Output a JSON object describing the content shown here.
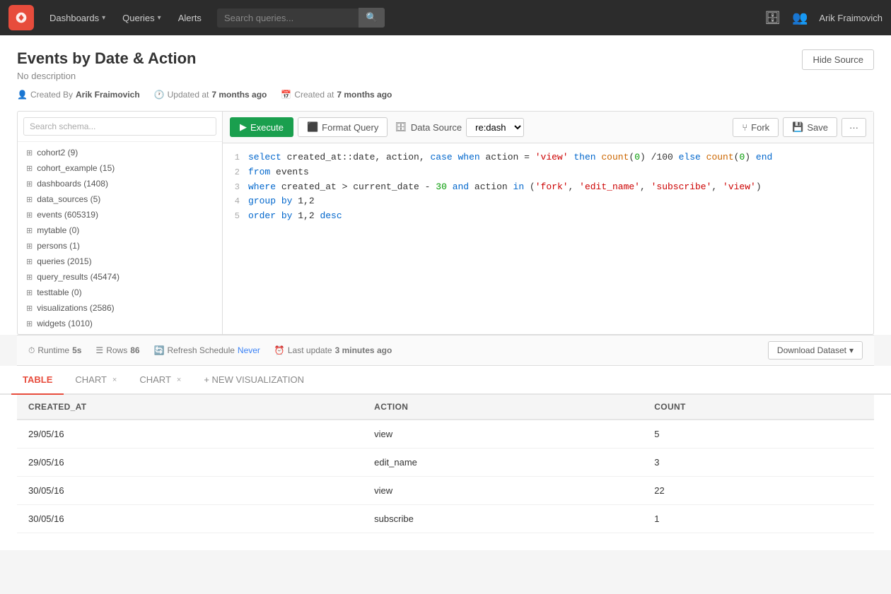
{
  "nav": {
    "dashboards_label": "Dashboards",
    "queries_label": "Queries",
    "alerts_label": "Alerts",
    "search_placeholder": "Search queries...",
    "user_name": "Arik Fraimovich"
  },
  "page": {
    "title": "Events by Date & Action",
    "description": "No description",
    "created_by_label": "Created By",
    "created_by": "Arik Fraimovich",
    "updated_at": "Updated at",
    "updated_at_when": "7 months ago",
    "created_at": "Created at",
    "created_at_when": "7 months ago",
    "hide_source_btn": "Hide Source"
  },
  "schema": {
    "search_placeholder": "Search schema...",
    "items": [
      {
        "name": "cohort2 (9)"
      },
      {
        "name": "cohort_example (15)"
      },
      {
        "name": "dashboards (1408)"
      },
      {
        "name": "data_sources (5)"
      },
      {
        "name": "events (605319)"
      },
      {
        "name": "mytable (0)"
      },
      {
        "name": "persons (1)"
      },
      {
        "name": "queries (2015)"
      },
      {
        "name": "query_results (45474)"
      },
      {
        "name": "testtable (0)"
      },
      {
        "name": "visualizations (2586)"
      },
      {
        "name": "widgets (1010)"
      }
    ]
  },
  "toolbar": {
    "execute_label": "Execute",
    "format_label": "Format Query",
    "datasource_label": "Data Source",
    "datasource_value": "re:dash",
    "fork_label": "Fork",
    "save_label": "Save",
    "more_label": "···"
  },
  "code": {
    "lines": [
      {
        "num": 1,
        "tokens": [
          {
            "t": "kw",
            "v": "select"
          },
          {
            "t": "plain",
            "v": " created_at::date, action, "
          },
          {
            "t": "kw",
            "v": "case"
          },
          {
            "t": "plain",
            "v": " "
          },
          {
            "t": "kw",
            "v": "when"
          },
          {
            "t": "plain",
            "v": " action = "
          },
          {
            "t": "str",
            "v": "'view'"
          },
          {
            "t": "plain",
            "v": " "
          },
          {
            "t": "kw",
            "v": "then"
          },
          {
            "t": "plain",
            "v": " "
          },
          {
            "t": "fn",
            "v": "count"
          },
          {
            "t": "plain",
            "v": "("
          },
          {
            "t": "num",
            "v": "0"
          },
          {
            "t": "plain",
            "v": ") /100 "
          },
          {
            "t": "kw",
            "v": "else"
          },
          {
            "t": "plain",
            "v": " "
          },
          {
            "t": "fn",
            "v": "count"
          },
          {
            "t": "plain",
            "v": "("
          },
          {
            "t": "num",
            "v": "0"
          },
          {
            "t": "plain",
            "v": ") "
          },
          {
            "t": "kw",
            "v": "end"
          }
        ]
      },
      {
        "num": 2,
        "tokens": [
          {
            "t": "kw",
            "v": "from"
          },
          {
            "t": "plain",
            "v": " events"
          }
        ]
      },
      {
        "num": 3,
        "tokens": [
          {
            "t": "kw",
            "v": "where"
          },
          {
            "t": "plain",
            "v": " created_at > current_date - "
          },
          {
            "t": "num",
            "v": "30"
          },
          {
            "t": "plain",
            "v": " "
          },
          {
            "t": "kw",
            "v": "and"
          },
          {
            "t": "plain",
            "v": " action "
          },
          {
            "t": "kw",
            "v": "in"
          },
          {
            "t": "plain",
            "v": " ("
          },
          {
            "t": "str",
            "v": "'fork'"
          },
          {
            "t": "plain",
            "v": ", "
          },
          {
            "t": "str",
            "v": "'edit_name'"
          },
          {
            "t": "plain",
            "v": ", "
          },
          {
            "t": "str",
            "v": "'subscribe'"
          },
          {
            "t": "plain",
            "v": ", "
          },
          {
            "t": "str",
            "v": "'view'"
          },
          {
            "t": "plain",
            "v": ")"
          }
        ]
      },
      {
        "num": 4,
        "tokens": [
          {
            "t": "kw",
            "v": "group"
          },
          {
            "t": "plain",
            "v": " "
          },
          {
            "t": "kw",
            "v": "by"
          },
          {
            "t": "plain",
            "v": " 1,2"
          }
        ]
      },
      {
        "num": 5,
        "tokens": [
          {
            "t": "kw",
            "v": "order"
          },
          {
            "t": "plain",
            "v": " "
          },
          {
            "t": "kw",
            "v": "by"
          },
          {
            "t": "plain",
            "v": " 1,2 "
          },
          {
            "t": "kw",
            "v": "desc"
          }
        ]
      }
    ]
  },
  "results_bar": {
    "runtime_label": "Runtime",
    "runtime_value": "5s",
    "rows_label": "Rows",
    "rows_value": "86",
    "refresh_label": "Refresh Schedule",
    "refresh_value": "Never",
    "last_update_label": "Last update",
    "last_update_value": "3 minutes ago",
    "download_label": "Download Dataset"
  },
  "tabs": [
    {
      "label": "TABLE",
      "active": true,
      "closeable": false
    },
    {
      "label": "CHART",
      "active": false,
      "closeable": true
    },
    {
      "label": "CHART",
      "active": false,
      "closeable": true
    },
    {
      "label": "+ NEW VISUALIZATION",
      "active": false,
      "closeable": false
    }
  ],
  "table": {
    "columns": [
      "CREATED_AT",
      "ACTION",
      "COUNT"
    ],
    "rows": [
      {
        "created_at": "29/05/16",
        "action": "view",
        "count": "5"
      },
      {
        "created_at": "29/05/16",
        "action": "edit_name",
        "count": "3"
      },
      {
        "created_at": "30/05/16",
        "action": "view",
        "count": "22"
      },
      {
        "created_at": "30/05/16",
        "action": "subscribe",
        "count": "1"
      }
    ]
  }
}
